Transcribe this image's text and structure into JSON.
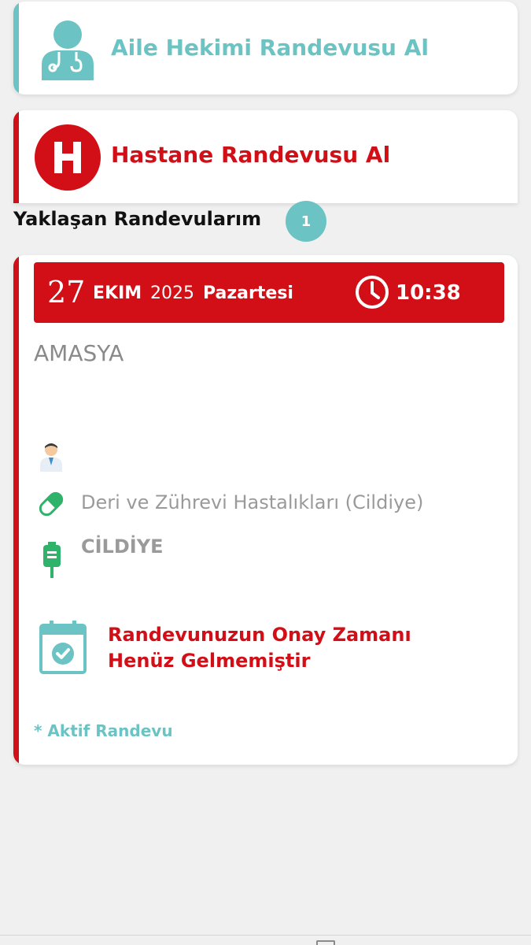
{
  "family_doctor": {
    "label": "Aile Hekimi Randevusu Al",
    "icon": "doctor-icon",
    "color": "#6cc3c4"
  },
  "hospital": {
    "label": "Hastane Randevusu Al",
    "icon_letter": "H",
    "color": "#d20e17"
  },
  "upcoming": {
    "title": "Yaklaşan Randevularım",
    "count": "1"
  },
  "appointment": {
    "day": "27",
    "month": "EKIM",
    "year": "2025",
    "weekday": "Pazartesi",
    "time": "10:38",
    "city": "AMASYA",
    "branch": "Deri ve Zührevi Hastalıkları (Cildiye)",
    "clinic": "CİLDİYE",
    "status_line1": "Randevunuzun Onay Zamanı",
    "status_line2": "Henüz Gelmemiştir",
    "active_label": "* Aktif Randevu"
  },
  "icons": [
    "doctor-icon",
    "hospital-h-icon",
    "clock-icon",
    "doctor-avatar-icon",
    "pill-icon",
    "iv-bag-icon",
    "calendar-check-icon"
  ],
  "colors": {
    "teal": "#6cc3c4",
    "red": "#d20e17",
    "background": "#f0f0f0",
    "gray_text": "#9a9a9a"
  }
}
